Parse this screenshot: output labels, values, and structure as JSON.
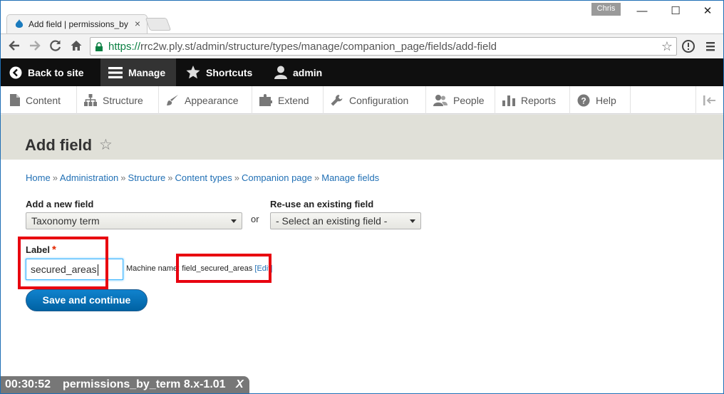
{
  "browser": {
    "tab_title": "Add field | permissions_by",
    "tab_close": "×",
    "user_badge": "Chris",
    "window_controls": {
      "minimize": "—",
      "maximize": "☐",
      "close": "✕"
    },
    "url_scheme": "https://",
    "url_rest": "rrc2w.ply.st/admin/structure/types/manage/companion_page/fields/add-field"
  },
  "admin_toolbar": {
    "back": "Back to site",
    "manage": "Manage",
    "shortcuts": "Shortcuts",
    "user": "admin"
  },
  "tray": [
    "Content",
    "Structure",
    "Appearance",
    "Extend",
    "Configuration",
    "People",
    "Reports",
    "Help"
  ],
  "page": {
    "title": "Add field",
    "breadcrumb": [
      "Home",
      "Administration",
      "Structure",
      "Content types",
      "Companion page",
      "Manage fields"
    ],
    "breadcrumb_sep": "»"
  },
  "form": {
    "new_field_label": "Add a new field",
    "new_field_value": "Taxonomy term",
    "or": "or",
    "existing_label": "Re-use an existing field",
    "existing_value": "- Select an existing field -",
    "label_label": "Label",
    "required_mark": "*",
    "label_value": "secured_areas",
    "machine_prefix": "Machine name: field_secured_areas",
    "machine_edit": "[Edit]",
    "submit": "Save and continue"
  },
  "recording": {
    "time": "00:30:52",
    "name": "permissions_by_term 8.x-1.01",
    "close": "X"
  },
  "colors": {
    "link": "#2170b5",
    "highlight": "#e8000f",
    "button": "#0074bd",
    "admin_bar": "#0f0f0f"
  }
}
